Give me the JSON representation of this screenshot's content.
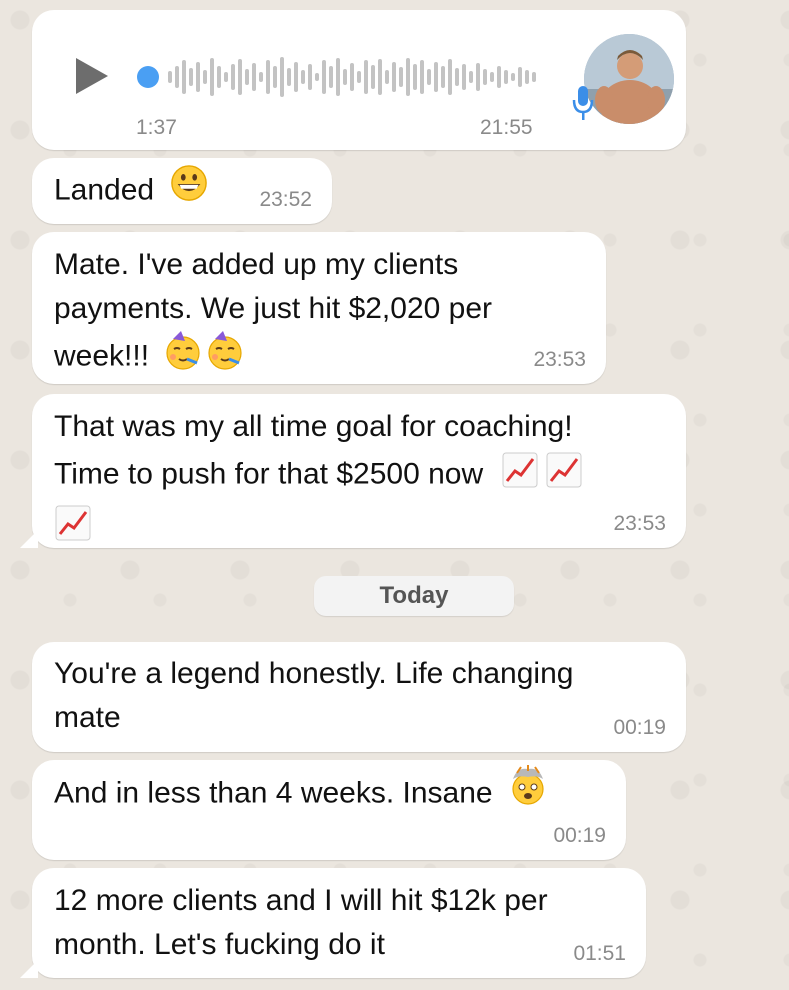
{
  "voice_message": {
    "duration": "1:37",
    "time": "21:55"
  },
  "messages": [
    {
      "text": "Landed",
      "emoji": "grinning-face",
      "time": "23:52"
    },
    {
      "text_lines": [
        "Mate. I've added up my clients",
        "payments. We just hit $2,020 per",
        "week!!!"
      ],
      "emoji": "partying-face x2",
      "time": "23:53"
    },
    {
      "text_lines": [
        "That was my all time goal for coaching!",
        "Time to push for that $2500 now"
      ],
      "emoji": "chart-increasing x3",
      "time": "23:53"
    },
    {
      "text_lines": [
        "You're a legend honestly. Life changing",
        "mate"
      ],
      "time": "00:19"
    },
    {
      "text": "And in less than 4 weeks. Insane",
      "emoji": "exploding-head",
      "time": "00:19"
    },
    {
      "text_lines": [
        "12 more clients and I will hit $12k per",
        "month. Let's fucking do it"
      ],
      "time": "01:51"
    }
  ],
  "date_separator": "Today",
  "colors": {
    "bubble": "#ffffff",
    "background": "#ebe6df",
    "time_text": "#8a8a8a",
    "voice_dot": "#4a9ff3"
  }
}
